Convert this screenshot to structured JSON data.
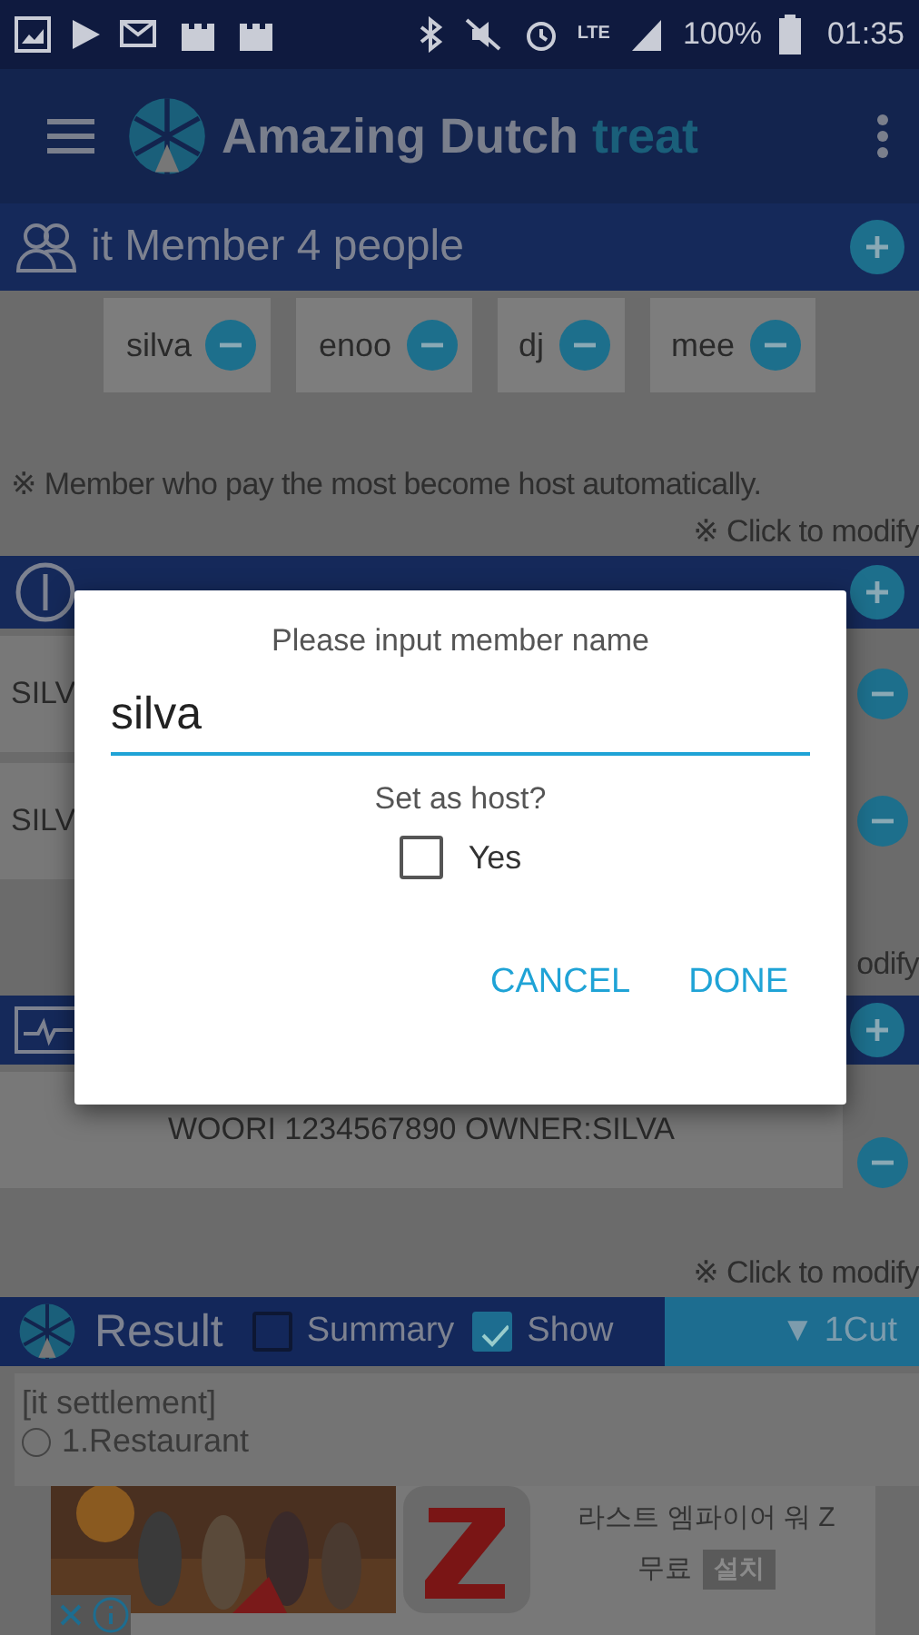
{
  "status_bar": {
    "network": "LTE",
    "battery": "100%",
    "time": "01:35"
  },
  "app_bar": {
    "title": "Amazing Dutch",
    "title_accent": "treat"
  },
  "members": {
    "title": "it Member 4 people",
    "chips": [
      {
        "name": "silva"
      },
      {
        "name": "enoo"
      },
      {
        "name": "dj"
      },
      {
        "name": "mee"
      }
    ],
    "notes": [
      "※ Member who pay the most become host automatically.",
      "※ Click to modify"
    ]
  },
  "payments": {
    "rows": [
      "SILV",
      "SILV"
    ],
    "note": "odify"
  },
  "accounts": {
    "rows": [
      "WOORI 1234567890 OWNER:SILVA"
    ],
    "note": "※ Click to modify"
  },
  "result": {
    "title": "Result",
    "options": [
      {
        "label": "Summary",
        "checked": false
      },
      {
        "label": "Show",
        "checked": true
      }
    ],
    "cut": "▼ 1Cut",
    "heading": "[it settlement]",
    "items": [
      {
        "label": "1.Restaurant",
        "selected": false
      }
    ]
  },
  "ad": {
    "title": "라스트 엠파이어 워 Z",
    "price": "무료",
    "install": "설치"
  },
  "dialog": {
    "title": "Please input member name",
    "value": "silva",
    "question": "Set as host?",
    "option": {
      "label": "Yes",
      "checked": false
    },
    "buttons": [
      "CANCEL",
      "DONE"
    ]
  }
}
